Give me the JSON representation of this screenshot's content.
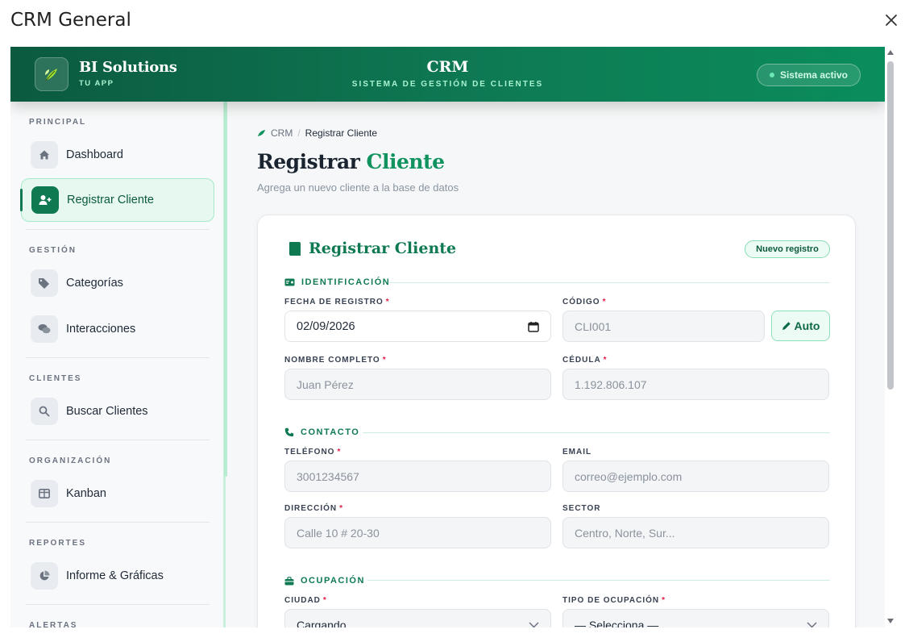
{
  "dialog": {
    "title": "CRM General"
  },
  "header": {
    "brand_name": "BI Solutions",
    "brand_sub": "TU APP",
    "app_title": "CRM",
    "app_sub": "SISTEMA DE GESTIÓN DE CLIENTES",
    "status": "Sistema activo"
  },
  "sidebar": {
    "sections": [
      {
        "label": "PRINCIPAL",
        "items": [
          {
            "label": "Dashboard",
            "icon": "home-icon"
          },
          {
            "label": "Registrar Cliente",
            "icon": "user-plus-icon",
            "active": true
          }
        ]
      },
      {
        "label": "GESTIÓN",
        "items": [
          {
            "label": "Categorías",
            "icon": "tags-icon"
          },
          {
            "label": "Interacciones",
            "icon": "chat-icon"
          }
        ]
      },
      {
        "label": "CLIENTES",
        "items": [
          {
            "label": "Buscar Clientes",
            "icon": "search-icon"
          }
        ]
      },
      {
        "label": "ORGANIZACIÓN",
        "items": [
          {
            "label": "Kanban",
            "icon": "kanban-icon"
          }
        ]
      },
      {
        "label": "REPORTES",
        "items": [
          {
            "label": "Informe & Gráficas",
            "icon": "pie-chart-icon"
          }
        ]
      },
      {
        "label": "ALERTAS",
        "items": []
      }
    ]
  },
  "breadcrumb": {
    "root": "CRM",
    "separator": "/",
    "current": "Registrar Cliente"
  },
  "page": {
    "title_main": "Registrar",
    "title_accent": "Cliente",
    "description": "Agrega un nuevo cliente a la base de datos"
  },
  "form": {
    "title": "Registrar Cliente",
    "badge": "Nuevo registro",
    "sections": {
      "identificacion": "IDENTIFICACIÓN",
      "contacto": "CONTACTO",
      "ocupacion": "OCUPACIÓN"
    },
    "fields": {
      "fecha": {
        "label": "FECHA DE REGISTRO",
        "value": "02/09/2026"
      },
      "codigo": {
        "label": "CÓDIGO",
        "placeholder": "CLI001"
      },
      "auto_button": "Auto",
      "nombre": {
        "label": "NOMBRE COMPLETO",
        "placeholder": "Juan Pérez"
      },
      "cedula": {
        "label": "CÉDULA",
        "placeholder": "1.192.806.107"
      },
      "telefono": {
        "label": "TELÉFONO",
        "placeholder": "3001234567"
      },
      "email": {
        "label": "EMAIL",
        "placeholder": "correo@ejemplo.com"
      },
      "direccion": {
        "label": "DIRECCIÓN",
        "placeholder": "Calle 10 # 20-30"
      },
      "sector": {
        "label": "SECTOR",
        "placeholder": "Centro, Norte, Sur..."
      },
      "ciudad": {
        "label": "CIUDAD",
        "value": "Cargando..."
      },
      "ocupacion": {
        "label": "TIPO DE OCUPACIÓN",
        "value": "— Selecciona —"
      }
    },
    "required_mark": "*"
  },
  "colors": {
    "brand": "#0f7a52",
    "accent": "#10935f",
    "required": "#e11d48"
  }
}
